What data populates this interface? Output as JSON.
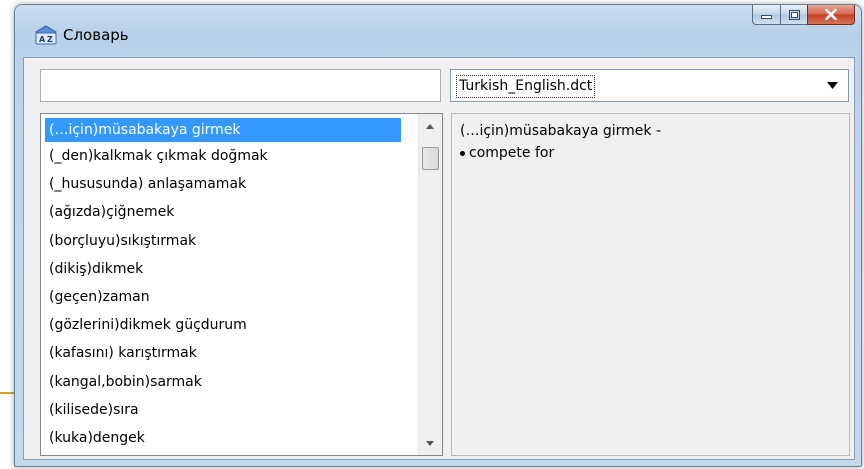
{
  "window": {
    "title": "Словарь"
  },
  "search": {
    "value": "",
    "placeholder": ""
  },
  "dictionary": {
    "selected": "Turkish_English.dct"
  },
  "word_list": {
    "items": [
      "(…için)müsabakaya girmek",
      "(_den)kalkmak çıkmak doğmak",
      "(_hususunda) anlaşamamak",
      "(ağızda)çiğnemek",
      "(borçluyu)sıkıştırmak",
      "(dikiş)dikmek",
      "(geçen)zaman",
      "(gözlerini)dikmek güçdurum",
      "(kafasını) karıştırmak",
      "(kangal,bobin)sarmak",
      "(kilisede)sıra",
      "(kuka)dengek"
    ],
    "selected_index": 0
  },
  "definition": {
    "headword": "(…için)müsabakaya girmek -",
    "meaning": "compete for"
  },
  "colors": {
    "selection": "#3399ff",
    "close_button": "#c44124"
  },
  "icons": [
    "dictionary-app-icon",
    "minimize-icon",
    "maximize-icon",
    "close-icon",
    "dropdown-arrow-icon",
    "scroll-up-icon",
    "scroll-down-icon"
  ]
}
